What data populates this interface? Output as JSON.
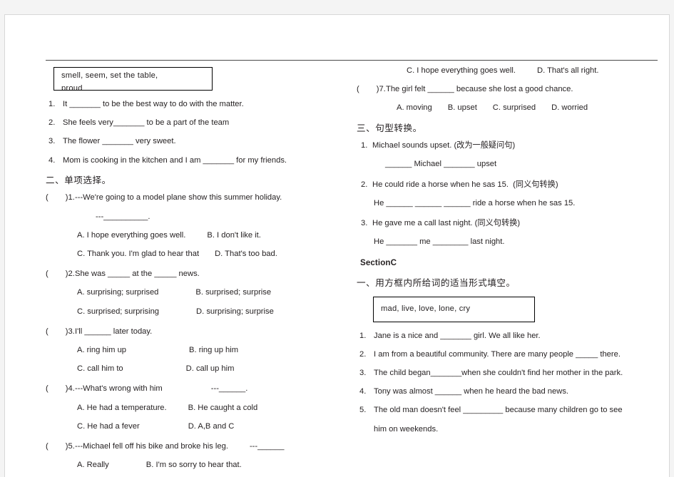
{
  "document": {
    "type": "english-worksheet",
    "page_background": "#f4f4f4",
    "paper_background": "#ffffff",
    "text_color": "#231f20"
  },
  "left_column": {
    "wordbox": {
      "line1": "smell,     seem,     set   the   table,",
      "line2": "proud"
    },
    "fill_items": [
      {
        "num": "1.",
        "text": "It _______ to be the best way to do with the matter."
      },
      {
        "num": "2.",
        "text": "She feels very_______ to be a part of the team"
      },
      {
        "num": "3.",
        "text": "The flower _______ very sweet."
      },
      {
        "num": "4.",
        "text": "Mom is cooking in the kitchen and I am _______ for my friends."
      }
    ],
    "section_two_heading": "二、单项选择。",
    "questions": [
      {
        "paren_left": "(",
        "paren_right": ")1.",
        "stem": "---We're going to a model plane show this summer holiday.",
        "stem2": "---__________.",
        "optionA": "A. I hope everything goes well.",
        "optionB": "B. I don't like it.",
        "optionC": "C. Thank you. I'm glad to hear that",
        "optionD": "D. That's too bad."
      },
      {
        "paren_left": "(",
        "paren_right": ")2.",
        "stem": "She was _____ at the _____ news.",
        "optionA": "A. surprising; surprised",
        "optionB": "B. surprised; surprise",
        "optionC": "C. surprised; surprising",
        "optionD": "D. surprising; surprise"
      },
      {
        "paren_left": "(",
        "paren_right": ")3.",
        "stem": "I'll ______ later today.",
        "optionA": "A. ring him up",
        "optionB": "B. ring up him",
        "optionC": "C. call him to",
        "optionD": "D. call up him"
      },
      {
        "paren_left": "(",
        "paren_right": ")4.",
        "stem": "---What's wrong with him",
        "stem_tail": "---______.",
        "optionA": "A. He had a temperature.",
        "optionB": "B. He caught a cold",
        "optionC": "C. He had a fever",
        "optionD": "D. A,B and C"
      },
      {
        "paren_left": "(",
        "paren_right": ")5.",
        "stem": "---Michael fell off his bike and broke his leg.",
        "stem_tail": "---______",
        "optionA": "A. Really",
        "optionB": "B. I'm so sorry to hear that."
      }
    ]
  },
  "right_column": {
    "q6_options": {
      "optionC": "C. I hope everything goes well.",
      "optionD": "D. That's all right."
    },
    "q7": {
      "paren_left": "(",
      "paren_right": ")7.",
      "stem": "The girl felt ______ because she lost a good chance.",
      "optionA": "A. moving",
      "optionB": "B. upset",
      "optionC": "C. surprised",
      "optionD": "D. worried"
    },
    "section_three_heading": "三、句型转换。",
    "transform_items": [
      {
        "num": "1.",
        "sentence": "Michael sounds upset.",
        "instruction": "(改为一般疑问句)",
        "answer_line": "______ Michael _______ upset"
      },
      {
        "num": "2.",
        "sentence": "He could ride a horse when he sas 15.",
        "instruction": "(同义句转换)",
        "answer_line": "He ______   ______   ______ ride a horse when he sas 15."
      },
      {
        "num": "3.",
        "sentence": "He gave me a call last night.",
        "instruction": "(同义句转换)",
        "answer_line": "He _______ me ________ last night."
      }
    ],
    "section_c_title": "SectionC",
    "section_c_heading": "一、用方框内所给词的适当形式填空。",
    "wordbox": "mad,    live,    love,    lone,    cry",
    "fill_items": [
      {
        "num": "1.",
        "text": "Jane is a nice and _______ girl. We all like her."
      },
      {
        "num": "2.",
        "text": "I am from a beautiful community. There are many people _____ there."
      },
      {
        "num": "3.",
        "text": "The child began_______when she couldn't find her mother in the park."
      },
      {
        "num": "4.",
        "text": "Tony was almost ______ when he heard the bad news."
      },
      {
        "num": "5.",
        "text": "The old man doesn't feel _________ because many children go to see",
        "text2": "him on weekends."
      }
    ]
  }
}
